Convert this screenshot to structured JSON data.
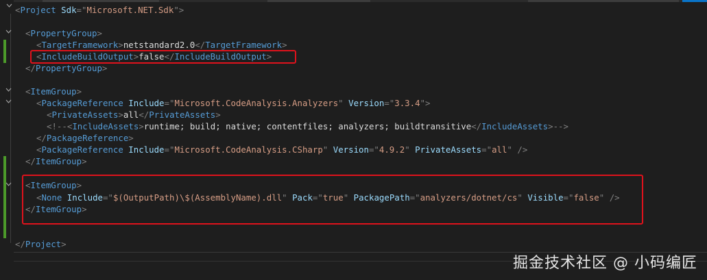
{
  "lines": [
    "<Project Sdk=\"Microsoft.NET.Sdk\">",
    "",
    "<PropertyGroup>",
    "<TargetFramework>netstandard2.0</TargetFramework>",
    "<IncludeBuildOutput>false</IncludeBuildOutput>",
    "</PropertyGroup>",
    "",
    "<ItemGroup>",
    "<PackageReference Include=\"Microsoft.CodeAnalysis.Analyzers\" Version=\"3.3.4\">",
    "<PrivateAssets>all</PrivateAssets>",
    "<!--<IncludeAssets>runtime; build; native; contentfiles; analyzers; buildtransitive</IncludeAssets>-->",
    "</PackageReference>",
    "<PackageReference Include=\"Microsoft.CodeAnalysis.CSharp\" Version=\"4.9.2\" PrivateAssets=\"all\" />",
    "</ItemGroup>",
    "",
    "<ItemGroup>",
    "<None Include=\"$(OutputPath)\\$(AssemblyName).dll\" Pack=\"true\" PackagePath=\"analyzers/dotnet/cs\" Visible=\"false\" />",
    "</ItemGroup>",
    "",
    "</Project>"
  ],
  "code": {
    "project_tag": "Project",
    "sdk_attr": "Sdk",
    "sdk_value": "Microsoft.NET.Sdk",
    "propertygroup_tag": "PropertyGroup",
    "targetframework_tag": "TargetFramework",
    "targetframework_value": "netstandard2.0",
    "includebuildoutput_tag": "IncludeBuildOutput",
    "includebuildoutput_value": "false",
    "itemgroup_tag": "ItemGroup",
    "packagereference_tag": "PackageReference",
    "include_attr": "Include",
    "version_attr": "Version",
    "privateassets_tag": "PrivateAssets",
    "privateassets_attr": "PrivateAssets",
    "analyzers_pkg": "Microsoft.CodeAnalysis.Analyzers",
    "analyzers_version": "3.3.4",
    "privateassets_value": "all",
    "comment_text": "<!--<IncludeAssets>runtime; build; native; contentfiles; analyzers; buildtransitive</IncludeAssets>-->",
    "comment_open": "<!--",
    "includeassets_tag": "IncludeAssets",
    "includeassets_value": "runtime; build; native; contentfiles; analyzers; buildtransitive",
    "comment_close": "-->",
    "csharp_pkg": "Microsoft.CodeAnalysis.CSharp",
    "csharp_version": "4.9.2",
    "none_tag": "None",
    "none_include": "$(OutputPath)\\$(AssemblyName).dll",
    "pack_attr": "Pack",
    "pack_value": "true",
    "packagepath_attr": "PackagePath",
    "packagepath_value": "analyzers/dotnet/cs",
    "visible_attr": "Visible",
    "visible_value": "false"
  },
  "watermark": "掘金技术社区 @ 小码编匠",
  "colors": {
    "background": "#1e1e1e",
    "tag": "#569cd6",
    "attribute": "#9cdcfe",
    "attr_value": "#d69d85",
    "punctuation": "#808080",
    "text": "#dcdcdc",
    "comment": "#57a64a",
    "highlight_box": "#e0121c",
    "change_marker": "#4c9a2a"
  }
}
